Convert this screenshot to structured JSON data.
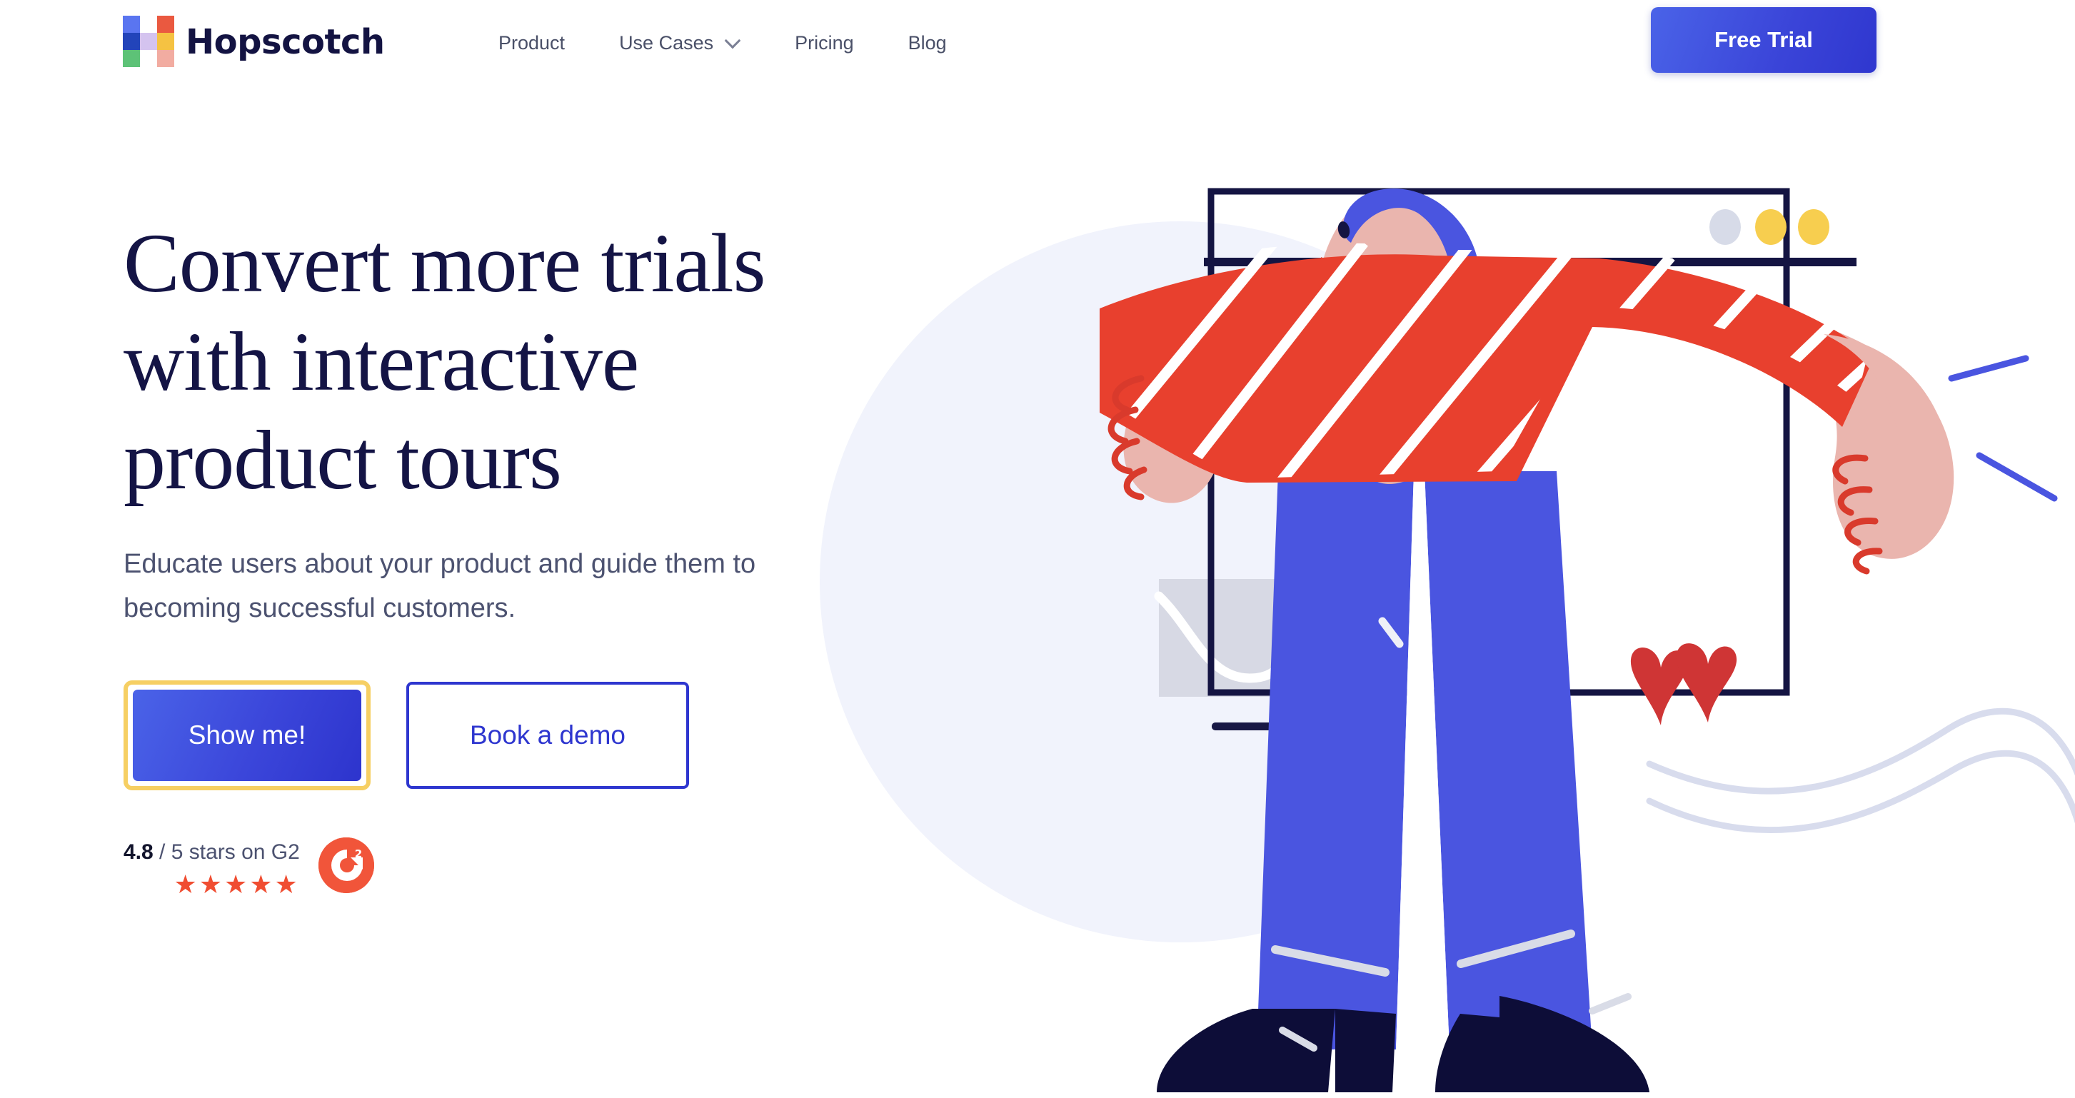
{
  "brand": {
    "name": "Hopscotch",
    "logo_colors": [
      "#5a75f0",
      "#ffffff",
      "#ea5940",
      "#2244ba",
      "#d4c3ef",
      "#f5c242",
      "#5dc277",
      "#ffffff",
      "#f2aca1"
    ],
    "logo_icon": "hopscotch-grid-logo"
  },
  "nav": {
    "items": [
      {
        "label": "Product",
        "has_dropdown": false
      },
      {
        "label": "Use Cases",
        "has_dropdown": true
      },
      {
        "label": "Pricing",
        "has_dropdown": false
      },
      {
        "label": "Blog",
        "has_dropdown": false
      }
    ],
    "cta_label": "Free Trial"
  },
  "hero": {
    "headline": "Convert more trials\nwith interactive\nproduct tours",
    "subhead": "Educate users about your product and guide them to\nbecoming successful customers.",
    "primary_cta": "Show me!",
    "secondary_cta": "Book a demo"
  },
  "rating": {
    "score": "4.8",
    "suffix": " / 5 stars on G2",
    "stars": "★★★★★",
    "star_count": 5,
    "badge_label": "G2",
    "badge_color": "#f1553a"
  },
  "colors": {
    "accent_blue": "#2e36cf",
    "gradient_blue": "#4a63e8",
    "navy_text": "#141445",
    "body_text": "#4c5270",
    "focus_ring_yellow": "#f6cf63",
    "bg_circle": "#f1f3fc",
    "illustration_red": "#e8402e",
    "illustration_blue": "#4a55e0",
    "illustration_skin": "#eab3ad",
    "illustration_navy": "#14143f",
    "heart_red": "#cf3535",
    "dot_gray": "#d7dbe8",
    "dot_yellow": "#f7ce4f",
    "wave_gray": "#d8dced"
  },
  "illustration": {
    "name": "person-in-browser-window-illustration",
    "window_dots": [
      "gray",
      "yellow",
      "yellow"
    ],
    "hearts": 2,
    "mini_chart_label": "mini-line-chart-card"
  }
}
